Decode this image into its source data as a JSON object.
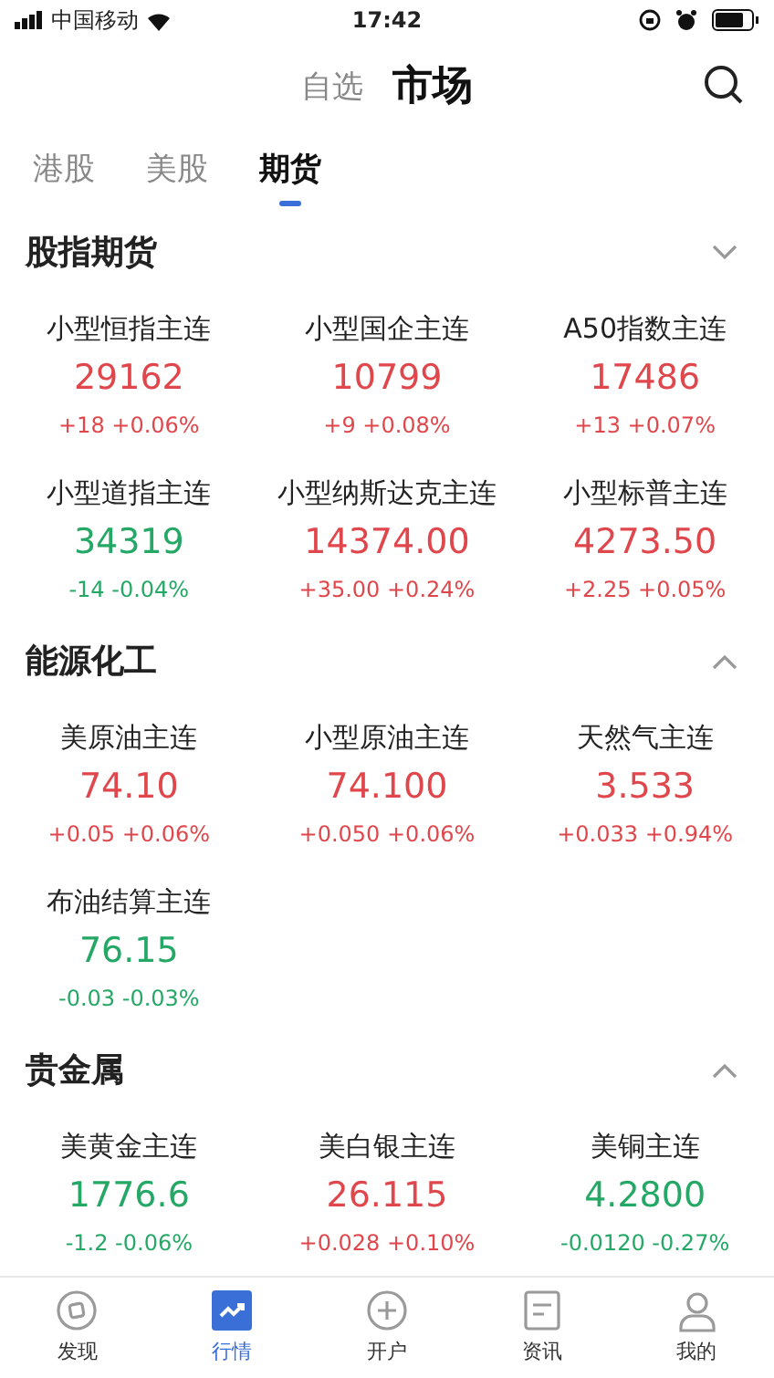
{
  "status_bar": {
    "carrier": "中国移动",
    "time": "17:42"
  },
  "header": {
    "tabs": [
      {
        "label": "自选",
        "selected": false
      },
      {
        "label": "市场",
        "selected": true
      }
    ]
  },
  "market_tabs": [
    {
      "label": "港股",
      "selected": false
    },
    {
      "label": "美股",
      "selected": false
    },
    {
      "label": "期货",
      "selected": true
    }
  ],
  "sections": [
    {
      "title": "股指期货",
      "expanded": false,
      "quotes": [
        {
          "name": "小型恒指主连",
          "price": "29162",
          "change": "+18",
          "percent": "+0.06%",
          "kind": "up"
        },
        {
          "name": "小型国企主连",
          "price": "10799",
          "change": "+9",
          "percent": "+0.08%",
          "kind": "up"
        },
        {
          "name": "A50指数主连",
          "price": "17486",
          "change": "+13",
          "percent": "+0.07%",
          "kind": "up"
        },
        {
          "name": "小型道指主连",
          "price": "34319",
          "change": "-14",
          "percent": "-0.04%",
          "kind": "down"
        },
        {
          "name": "小型纳斯达克主连",
          "price": "14374.00",
          "change": "+35.00",
          "percent": "+0.24%",
          "kind": "up"
        },
        {
          "name": "小型标普主连",
          "price": "4273.50",
          "change": "+2.25",
          "percent": "+0.05%",
          "kind": "up"
        }
      ]
    },
    {
      "title": "能源化工",
      "expanded": true,
      "quotes": [
        {
          "name": "美原油主连",
          "price": "74.10",
          "change": "+0.05",
          "percent": "+0.06%",
          "kind": "up"
        },
        {
          "name": "小型原油主连",
          "price": "74.100",
          "change": "+0.050",
          "percent": "+0.06%",
          "kind": "up"
        },
        {
          "name": "天然气主连",
          "price": "3.533",
          "change": "+0.033",
          "percent": "+0.94%",
          "kind": "up"
        },
        {
          "name": "布油结算主连",
          "price": "76.15",
          "change": "-0.03",
          "percent": "-0.03%",
          "kind": "down"
        }
      ]
    },
    {
      "title": "贵金属",
      "expanded": true,
      "quotes": [
        {
          "name": "美黄金主连",
          "price": "1776.6",
          "change": "-1.2",
          "percent": "-0.06%",
          "kind": "down"
        },
        {
          "name": "美白银主连",
          "price": "26.115",
          "change": "+0.028",
          "percent": "+0.10%",
          "kind": "up"
        },
        {
          "name": "美铜主连",
          "price": "4.2800",
          "change": "-0.0120",
          "percent": "-0.27%",
          "kind": "down"
        }
      ]
    }
  ],
  "bottom_nav": [
    {
      "label": "发现",
      "kind": "discover",
      "selected": false
    },
    {
      "label": "行情",
      "kind": "quotes",
      "selected": true
    },
    {
      "label": "开户",
      "kind": "open_account",
      "selected": false
    },
    {
      "label": "资讯",
      "kind": "news",
      "selected": false
    },
    {
      "label": "我的",
      "kind": "profile",
      "selected": false
    }
  ]
}
